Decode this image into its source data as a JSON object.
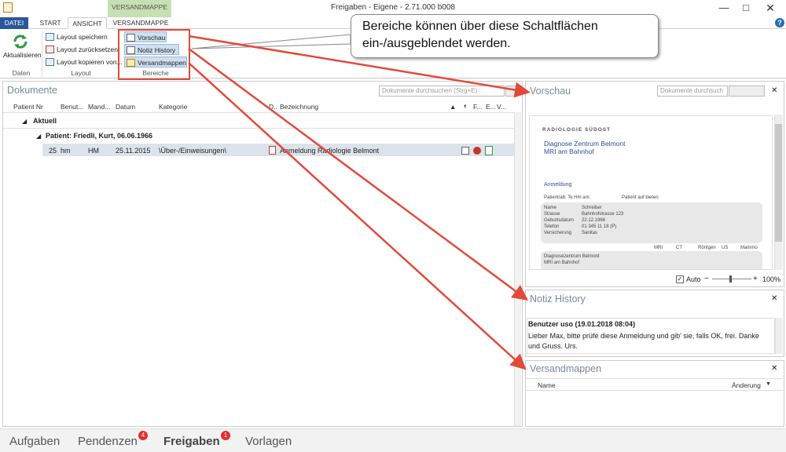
{
  "window": {
    "title": "Freigaben - Eigene - 2.71.000 b008",
    "close": "✕",
    "help": "?"
  },
  "ribbon": {
    "context_tab": "VERSANDMAPPE",
    "tabs": [
      "DATEI",
      "START",
      "ANSICHT",
      "VERSANDMAPPE"
    ],
    "refresh": "Aktualisieren",
    "layout_items": [
      "Layout speichern",
      "Layout zurücksetzen",
      "Layout kopieren von..."
    ],
    "bereiche_items": [
      "Vorschau",
      "Notiz History",
      "Versandmappen"
    ],
    "groups": [
      "Daten",
      "Layout",
      "Bereiche"
    ]
  },
  "callout": "Bereiche können über diese Schaltflächen ein-/ausgeblendet werden.",
  "documents": {
    "title": "Dokumente",
    "search_placeholder": "Dokumente durchsuchen (Strg+E)",
    "columns": [
      "Patient Nr",
      "Benut...",
      "Mand...",
      "Datum",
      "Kategorie",
      "D..",
      "Bezeichnung",
      "",
      "F...",
      "E...",
      "V..."
    ],
    "group_current": "Aktuell",
    "group_patient": "Patient: Friedli, Kurt, 06.06.1966",
    "row": {
      "nr": "25",
      "user": "hm",
      "mand": "HM",
      "date": "25.11.2015",
      "category": "\\Über-/Einweisungen\\",
      "title": "Anmeldung Radiologie Belmont"
    }
  },
  "preview": {
    "title": "Vorschau",
    "search_placeholder": "Dokumente durchsuch",
    "auto": "Auto",
    "zoom": "100%",
    "doc": {
      "logo": "RADIOLOGIE SÜDOST",
      "heading1": "Diagnose Zentrum Belmont",
      "heading2": "MRI am Bahnhof",
      "section": "Anmeldung",
      "patient_label": "Patient/ab: Te Hm am:",
      "checkbox_label": "Patient auf bieten",
      "row_labels": [
        "Name",
        "Strasse",
        "Geburtsdatum",
        "Telefon",
        "Versicherung"
      ],
      "row_values": [
        "Schreiber",
        "Bahnhofstrasse 123",
        "22.12.1966",
        "01 345 11 18 (P)",
        "Sanitas"
      ],
      "institute": "Diagnosezentrum Belmont",
      "mri": "MRI am Bahnhof",
      "modalities": [
        "MRI",
        "CT",
        "Röntgen",
        "US",
        "Mammo"
      ]
    }
  },
  "notiz": {
    "title": "Notiz History",
    "author": "Benutzer uso (19.01.2018 08:04)",
    "text": "Lieber Max, bitte prüfe diese Anmeldung und gib' sie, falls OK, frei. Danke und Gruss. Urs."
  },
  "versand": {
    "title": "Versandmappen",
    "col_name": "Name",
    "col_change": "Änderung"
  },
  "bottom": {
    "tabs": [
      "Aufgaben",
      "Pendenzen",
      "Freigaben",
      "Vorlagen"
    ],
    "badges": [
      "4",
      "1"
    ]
  },
  "colors": {
    "accent": "#2b579a",
    "context": "#c6e0b4",
    "annotation": "#e24a3b"
  }
}
